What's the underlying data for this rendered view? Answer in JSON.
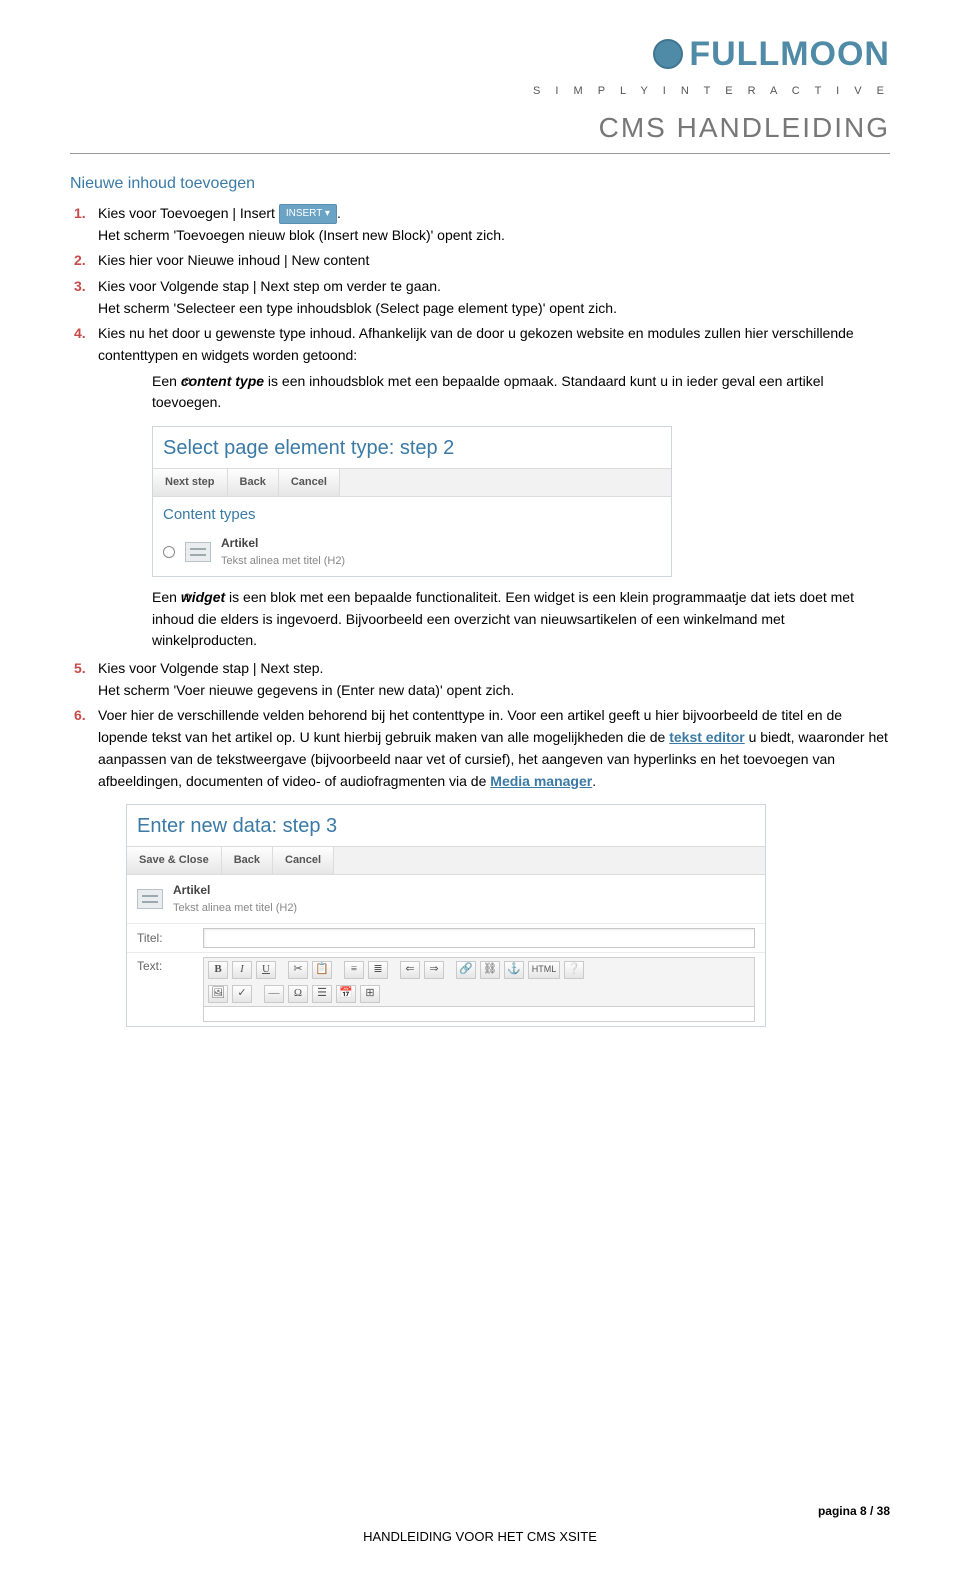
{
  "brand": {
    "name": "FULLMOON",
    "tagline": "S I M P L Y   I N T E R A C T I V E"
  },
  "doc_title": "CMS HANDLEIDING",
  "section_title": "Nieuwe inhoud toevoegen",
  "steps": {
    "s1": {
      "num": "1.",
      "pre": "Kies voor Toevoegen | Insert",
      "badge": "INSERT ▾",
      "post": ".",
      "note": "Het scherm 'Toevoegen nieuw blok (Insert new Block)' opent zich."
    },
    "s2": {
      "num": "2.",
      "text": "Kies hier voor Nieuwe inhoud | New content"
    },
    "s3": {
      "num": "3.",
      "text": "Kies voor Volgende stap | Next step om verder te gaan.",
      "note": "Het scherm 'Selecteer een type inhoudsblok (Select page element type)' opent zich."
    },
    "s4": {
      "num": "4.",
      "text": "Kies nu het door u gewenste type inhoud. Afhankelijk van de door u gekozen website en modules zullen hier verschillende contenttypen en widgets worden getoond:",
      "sub_a": {
        "bullet": "o",
        "text_pre": "Een ",
        "emph": "content type",
        "text_post": " is een inhoudsblok met een bepaalde opmaak. Standaard kunt u in ieder geval een artikel toevoegen."
      },
      "sub_b": {
        "bullet": "o",
        "text_pre": "Een ",
        "emph": "widget",
        "text_post": " is een blok met een bepaalde functionaliteit. Een widget is een klein programmaatje dat iets doet met inhoud die elders is ingevoerd. Bijvoorbeeld een overzicht van nieuwsartikelen of een winkelmand met winkelproducten."
      }
    },
    "s5": {
      "num": "5.",
      "text": "Kies voor Volgende stap | Next step.",
      "note": "Het scherm 'Voer nieuwe gegevens in (Enter new data)' opent zich."
    },
    "s6": {
      "num": "6.",
      "text_a": "Voer hier de verschillende velden behorend bij het contenttype in. Voor een artikel geeft u hier bijvoorbeeld de titel en de lopende tekst van het artikel op. U kunt hierbij gebruik maken van alle mogelijkheden die de ",
      "link1": "tekst editor",
      "text_b": " u biedt, waaronder het aanpassen van de tekstweergave (bijvoorbeeld naar vet of cursief), het aangeven van hyperlinks en het toevoegen van afbeeldingen, documenten of video- of audiofragmenten via de ",
      "link2": "Media manager",
      "text_c": "."
    }
  },
  "panel1": {
    "title": "Select page element type: step 2",
    "tabs": [
      "Next step",
      "Back",
      "Cancel"
    ],
    "section": "Content types",
    "item_title": "Artikel",
    "item_sub": "Tekst alinea met titel (H2)"
  },
  "panel2": {
    "title": "Enter new data: step 3",
    "tabs": [
      "Save & Close",
      "Back",
      "Cancel"
    ],
    "item_title": "Artikel",
    "item_sub": "Tekst alinea met titel (H2)",
    "label_title": "Titel:",
    "label_text": "Text:",
    "tb": [
      "B",
      "I",
      "U",
      "✂",
      "📋",
      "≡",
      "≣",
      "⇐",
      "⇒",
      "🔗",
      "⛓",
      "⚓",
      "HTML",
      "❔",
      "🖼",
      "✓",
      "—",
      "Ω",
      "☰",
      "📅",
      "⊞"
    ]
  },
  "footer": {
    "page": "pagina 8 / 38",
    "center": "HANDLEIDING VOOR HET CMS XSITE"
  }
}
